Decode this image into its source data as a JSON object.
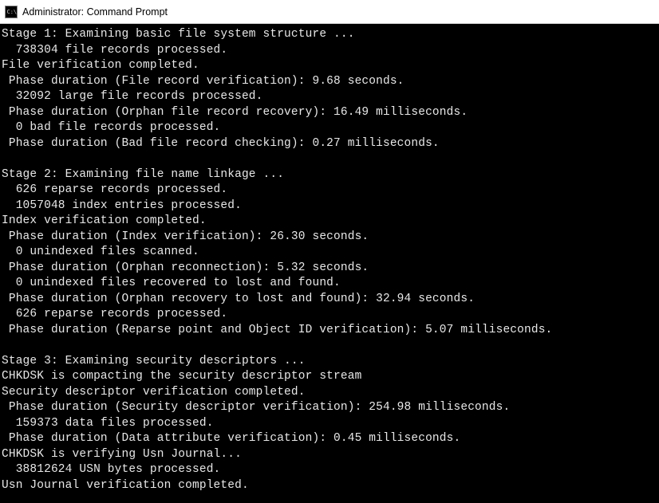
{
  "window": {
    "title": "Administrator: Command Prompt"
  },
  "lines": [
    "Stage 1: Examining basic file system structure ...",
    "  738304 file records processed.",
    "File verification completed.",
    " Phase duration (File record verification): 9.68 seconds.",
    "  32092 large file records processed.",
    " Phase duration (Orphan file record recovery): 16.49 milliseconds.",
    "  0 bad file records processed.",
    " Phase duration (Bad file record checking): 0.27 milliseconds.",
    "",
    "Stage 2: Examining file name linkage ...",
    "  626 reparse records processed.",
    "  1057048 index entries processed.",
    "Index verification completed.",
    " Phase duration (Index verification): 26.30 seconds.",
    "  0 unindexed files scanned.",
    " Phase duration (Orphan reconnection): 5.32 seconds.",
    "  0 unindexed files recovered to lost and found.",
    " Phase duration (Orphan recovery to lost and found): 32.94 seconds.",
    "  626 reparse records processed.",
    " Phase duration (Reparse point and Object ID verification): 5.07 milliseconds.",
    "",
    "Stage 3: Examining security descriptors ...",
    "CHKDSK is compacting the security descriptor stream",
    "Security descriptor verification completed.",
    " Phase duration (Security descriptor verification): 254.98 milliseconds.",
    "  159373 data files processed.",
    " Phase duration (Data attribute verification): 0.45 milliseconds.",
    "CHKDSK is verifying Usn Journal...",
    "  38812624 USN bytes processed.",
    "Usn Journal verification completed."
  ]
}
